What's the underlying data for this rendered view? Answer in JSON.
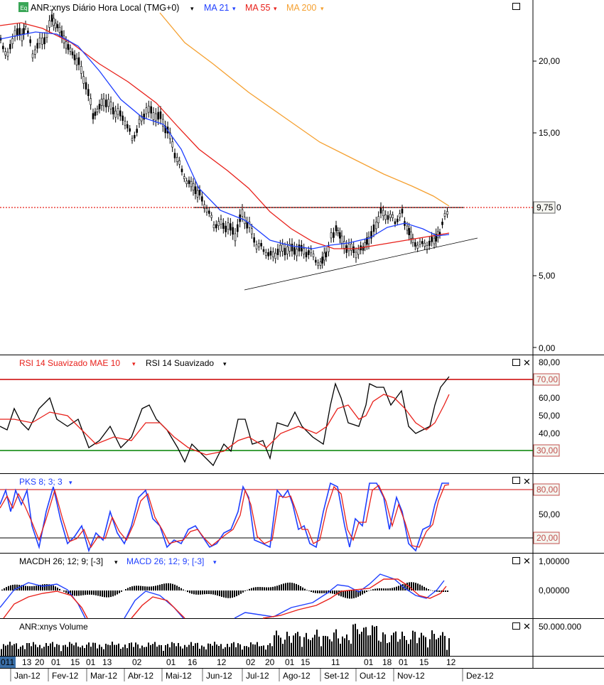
{
  "main_panel": {
    "badge": "Eq",
    "symbol_label": "ANR:xnys Diário Hora Local (TMG+0)",
    "indicators": [
      {
        "label": "MA 21",
        "color": "#1f3fff"
      },
      {
        "label": "MA 55",
        "color": "#e8201a"
      },
      {
        "label": "MA 200",
        "color": "#f5a030"
      }
    ],
    "price_ticks": [
      "20,00",
      "15,00",
      "9,75",
      "5,00",
      "0,00"
    ],
    "current_price_label": "9,75",
    "resistance_level": 9.75
  },
  "rsi_panel": {
    "labels": [
      {
        "text": "RSI 14 Suavizado MAE 10",
        "color": "#e8201a"
      },
      {
        "text": "RSI 14 Suavizado",
        "color": "#000000"
      }
    ],
    "ticks": [
      "80,00",
      "70,00",
      "60,00",
      "50,00",
      "40,00",
      "30,00"
    ],
    "upper_level_label": "70,00",
    "lower_level_label": "30,00"
  },
  "pks_panel": {
    "label": "PKS 8; 3; 3",
    "color": "#1f3fff",
    "ticks": [
      "80,00",
      "50,00",
      "20,00"
    ]
  },
  "macd_panel": {
    "labels": [
      {
        "text": "MACDH 26; 12; 9; [-3]",
        "color": "#000000"
      },
      {
        "text": "MACD 26; 12; 9; [-3]",
        "color": "#1f3fff"
      }
    ],
    "ticks": [
      "1,00000",
      "0,00000"
    ]
  },
  "volume_panel": {
    "label": "ANR:xnys Volume",
    "ticks": [
      "50.000.000"
    ]
  },
  "x_axis": {
    "day_labels": [
      "011",
      "13",
      "20",
      "01",
      "15",
      "01",
      "13",
      "02",
      "01",
      "16",
      "12",
      "02",
      "20",
      "01",
      "15",
      "11",
      "01",
      "18",
      "01",
      "15",
      "12"
    ],
    "month_labels": [
      "Jan-12",
      "Fev-12",
      "Mar-12",
      "Abr-12",
      "Mai-12",
      "Jun-12",
      "Jul-12",
      "Ago-12",
      "Set-12",
      "Out-12",
      "Nov-12",
      "Dez-12"
    ]
  },
  "chart_data": {
    "type": "candlestick",
    "title": "ANR:xnys Diário Hora Local (TMG+0)",
    "period": "2012-01 to 2012-12",
    "price_axis": {
      "ylim": [
        0,
        24
      ]
    },
    "price_path_close": [
      {
        "x": "Jan-12",
        "y": 20.5
      },
      {
        "x": "Jan-12 mid",
        "y": 21.5
      },
      {
        "x": "Fev-12",
        "y": 23.0
      },
      {
        "x": "Fev-12 mid",
        "y": 21.0
      },
      {
        "x": "Mar-12",
        "y": 17.0
      },
      {
        "x": "Mar-12 mid",
        "y": 16.5
      },
      {
        "x": "Abr-12",
        "y": 15.0
      },
      {
        "x": "Abr-12 mid",
        "y": 16.5
      },
      {
        "x": "Mai-12",
        "y": 13.0
      },
      {
        "x": "Mai-12 mid",
        "y": 11.5
      },
      {
        "x": "Jun-12",
        "y": 9.0
      },
      {
        "x": "Jun-12 mid",
        "y": 8.5
      },
      {
        "x": "Jul-12",
        "y": 7.0
      },
      {
        "x": "Jul-12 mid",
        "y": 6.5
      },
      {
        "x": "Ago-12",
        "y": 7.0
      },
      {
        "x": "Ago-12 mid",
        "y": 6.5
      },
      {
        "x": "Set-12",
        "y": 6.0
      },
      {
        "x": "Set-12 mid",
        "y": 8.5
      },
      {
        "x": "Out-12",
        "y": 7.5
      },
      {
        "x": "Out-12 mid",
        "y": 9.5
      },
      {
        "x": "Nov-12",
        "y": 7.5
      },
      {
        "x": "Nov-12 mid",
        "y": 7.2
      },
      {
        "x": "Dez-12",
        "y": 9.75
      }
    ],
    "moving_averages": [
      {
        "name": "MA 21",
        "values": [
          20.5,
          21.0,
          21.8,
          21.0,
          18.5,
          16.5,
          15.5,
          15.5,
          14.0,
          12.0,
          10.0,
          9.0,
          8.0,
          7.2,
          7.0,
          6.8,
          6.5,
          7.5,
          7.5,
          8.5,
          8.2,
          7.5,
          8.0
        ]
      },
      {
        "name": "MA 55",
        "values": [
          22.0,
          22.0,
          21.5,
          21.0,
          20.0,
          18.5,
          17.0,
          16.5,
          15.5,
          14.0,
          12.0,
          10.5,
          9.0,
          8.0,
          7.5,
          7.2,
          7.0,
          7.0,
          7.0,
          7.5,
          7.6,
          7.6,
          7.9
        ]
      },
      {
        "name": "MA 200",
        "values": [
          null,
          null,
          null,
          null,
          25.0,
          23.0,
          21.5,
          20.0,
          18.5,
          17.2,
          16.0,
          15.0,
          14.0,
          13.3,
          12.6,
          12.0,
          11.5,
          11.0,
          10.6,
          10.3,
          10.1,
          9.9,
          9.8
        ]
      }
    ],
    "annotations": [
      {
        "type": "horizontal-line",
        "value": 9.75
      },
      {
        "type": "trendline",
        "from": {
          "x": "Jul-12",
          "y": 4.0
        },
        "to": {
          "x": "Dez-12",
          "y": 7.5
        }
      }
    ]
  }
}
